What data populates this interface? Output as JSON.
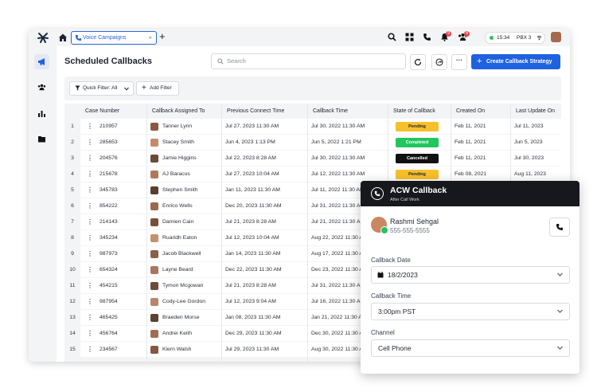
{
  "topbar": {
    "tab_label": "Voice Campaigns",
    "tab_close": "×",
    "new_tab": "+",
    "notification_badge_1": "9",
    "notification_badge_2": "4",
    "status_time": "15:34",
    "status_pbx": "PBX 3"
  },
  "page": {
    "title": "Scheduled Callbacks",
    "search_placeholder": "Search",
    "more_label": "···",
    "create_button": "Create Callback Strategy",
    "quick_filter": "Quick Filter: All",
    "add_filter": "Add Filter"
  },
  "table": {
    "headers": [
      "Case Number",
      "Callback Assigned To",
      "Previous Connect Time",
      "Callback Time",
      "State of Callback",
      "Created On",
      "Last Update On"
    ],
    "rows": [
      {
        "n": "1",
        "case": "210957",
        "agent": "Tanner Lynn",
        "prev": "Jul 27, 2023 11:30 AM",
        "cb": "Jul 30, 2022 11:30 AM",
        "state": "Pending",
        "created": "Feb 11, 2021",
        "updated": "Jul 11, 2023"
      },
      {
        "n": "2",
        "case": "285653",
        "agent": "Stacey Smith",
        "prev": "Jun 4, 2023 1:13 PM",
        "cb": "Jun 5, 2022 1:21 PM",
        "state": "Completed",
        "created": "Feb 11, 2021",
        "updated": "Jun 5, 2023"
      },
      {
        "n": "3",
        "case": "204576",
        "agent": "Jamie Higgins",
        "prev": "Jul 22, 2023 8:28 AM",
        "cb": "Jul 30, 2022 11:30 AM",
        "state": "Cancelled",
        "created": "Feb 11, 2021",
        "updated": "Jul 30, 2023"
      },
      {
        "n": "4",
        "case": "215678",
        "agent": "AJ Baracus",
        "prev": "Jul 27, 2023 10:04 AM",
        "cb": "Jul 12, 2022 11:30 AM",
        "state": "Pending",
        "created": "Feb 08, 2021",
        "updated": "Aug 11, 2023"
      },
      {
        "n": "5",
        "case": "345783",
        "agent": "Stephen Smith",
        "prev": "Jan 11, 2023 11:30 AM",
        "cb": "Jul 11, 2022 11:30 AM",
        "state": "",
        "created": "",
        "updated": ""
      },
      {
        "n": "6",
        "case": "854222",
        "agent": "Enrico Wells",
        "prev": "Dec 20, 2023 11:30 AM",
        "cb": "Jul 31, 2022 11:30 AM",
        "state": "",
        "created": "",
        "updated": ""
      },
      {
        "n": "7",
        "case": "214143",
        "agent": "Damien Cain",
        "prev": "Jul 21, 2023 8:28 AM",
        "cb": "Jul 21, 2022 11:30 AM",
        "state": "",
        "created": "",
        "updated": ""
      },
      {
        "n": "8",
        "case": "345234",
        "agent": "Ruaridh Eaton",
        "prev": "Jul 12, 2023 10:04 AM",
        "cb": "Aug 22, 2022 11:30 AM",
        "state": "",
        "created": "",
        "updated": ""
      },
      {
        "n": "9",
        "case": "987973",
        "agent": "Jacob Blackwell",
        "prev": "Jan 14, 2023 11:30 AM",
        "cb": "Aug 17, 2022 11:30 AM",
        "state": "",
        "created": "",
        "updated": ""
      },
      {
        "n": "10",
        "case": "654324",
        "agent": "Layne Beard",
        "prev": "Dec 22, 2023 11:30 AM",
        "cb": "Dec 23, 2022 11:30 AM",
        "state": "",
        "created": "",
        "updated": ""
      },
      {
        "n": "11",
        "case": "454215",
        "agent": "Tymon Mcgowan",
        "prev": "Jul 21, 2023 8:28 AM",
        "cb": "Jul 31, 2022 11:30 AM",
        "state": "",
        "created": "",
        "updated": ""
      },
      {
        "n": "12",
        "case": "987954",
        "agent": "Cody-Lee Gordon",
        "prev": "Jul 12, 2023 9:04 AM",
        "cb": "Jul 16, 2022 11:30 AM",
        "state": "",
        "created": "",
        "updated": ""
      },
      {
        "n": "13",
        "case": "465425",
        "agent": "Braeden Morse",
        "prev": "Jan 08, 2023 11:30 AM",
        "cb": "Jan 21, 2022 11:30 AM",
        "state": "",
        "created": "",
        "updated": ""
      },
      {
        "n": "14",
        "case": "456764",
        "agent": "Andrei Keith",
        "prev": "Dec 29, 2023 11:30 AM",
        "cb": "Dec 30, 2022 11:30 AM",
        "state": "",
        "created": "",
        "updated": ""
      },
      {
        "n": "15",
        "case": "234567",
        "agent": "Kiern Walsh",
        "prev": "Jul 29, 2023 11:30 AM",
        "cb": "Aug 30, 2022 11:30 AM",
        "state": "",
        "created": "",
        "updated": ""
      }
    ]
  },
  "panel": {
    "title": "ACW Callback",
    "subtitle": "After Call Work",
    "contact_name": "Rashmi Sehgal",
    "contact_phone": "555-555-5555",
    "date_label": "Callback Date",
    "date_value": "18/2/2023",
    "time_label": "Callback Time",
    "time_value": "3:00pm PST",
    "channel_label": "Channel",
    "channel_value": "Cell Phone"
  },
  "colors": {
    "accent": "#1f62e0",
    "pending": "#f6c02a",
    "completed": "#22c55e",
    "cancelled": "#111111",
    "panel_header": "#16181d"
  }
}
